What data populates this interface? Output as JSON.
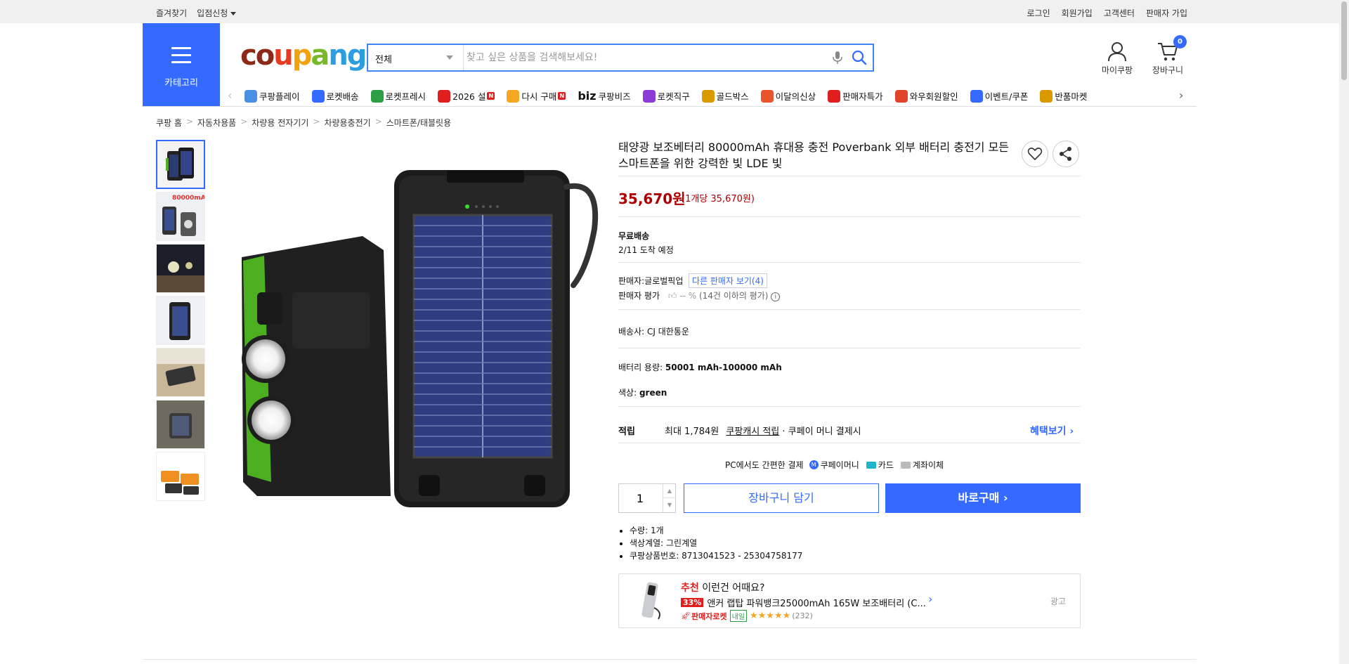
{
  "topbar": {
    "left": [
      "즐겨찾기",
      "입점신청"
    ],
    "right": [
      "로그인",
      "회원가입",
      "고객센터",
      "판매자 가입"
    ]
  },
  "header": {
    "category_label": "카테고리",
    "logo": {
      "c1": "co",
      "c2": "u",
      "c3": "p",
      "c4": "a",
      "c5": "ng"
    },
    "search_category": "전체",
    "search_placeholder": "찾고 싶은 상품을 검색해보세요!",
    "mycoupang_label": "마이쿠팡",
    "cart_label": "장바구니",
    "cart_count": "0"
  },
  "gnb": [
    {
      "label": "쿠팡플레이",
      "icon": "play-icon",
      "color": "#4a90e2"
    },
    {
      "label": "로켓배송",
      "icon": "rocket-icon",
      "color": "#346aff"
    },
    {
      "label": "로켓프레시",
      "icon": "rocket-fresh-icon",
      "color": "#2e9e44"
    },
    {
      "label": "2026 설",
      "icon": "gift-icon",
      "color": "#e01e1e",
      "badge": "N"
    },
    {
      "label": "다시 구매",
      "icon": "rebuy-icon",
      "color": "#f5a623",
      "badge": "N"
    },
    {
      "label": "쿠팡비즈",
      "icon": "biz-icon",
      "color": "#111",
      "prefix": "biz"
    },
    {
      "label": "로켓직구",
      "icon": "global-icon",
      "color": "#8b3ad6"
    },
    {
      "label": "골드박스",
      "icon": "goldbox-icon",
      "color": "#d99a00"
    },
    {
      "label": "이달의신상",
      "icon": "new-icon",
      "color": "#e8542b"
    },
    {
      "label": "판매자특가",
      "icon": "seller-deal-icon",
      "color": "#e01e1e"
    },
    {
      "label": "와우회원할인",
      "icon": "wow-icon",
      "color": "#e0442b"
    },
    {
      "label": "이벤트/쿠폰",
      "icon": "coupon-icon",
      "color": "#346aff"
    },
    {
      "label": "반품마켓",
      "icon": "return-market-icon",
      "color": "#d99a00"
    }
  ],
  "breadcrumb": [
    "쿠팡 홈",
    "자동차용품",
    "차량용 전자기기",
    "차량용충전기",
    "스마트폰/태블릿용"
  ],
  "product": {
    "title": "태양광 보조베터리 80000mAh 휴대용 충전 Poverbank 외부 배터리 충전기 모든 스마트폰을 위한 강력한 빛 LDE 빛",
    "price": "35,670원",
    "unit_price": "(1개당 35,670원)",
    "shipping_title": "무료배송",
    "arrival": "2/11 도착 예정",
    "seller_label": "판매자:",
    "seller_name": "글로벌픽업",
    "other_seller": "다른 판매자 보기(4)",
    "seller_rating_label": "판매자 평가",
    "seller_rating_value": "-- %",
    "seller_rating_note": "(14건 이하의 평가)",
    "courier_label": "배송사:",
    "courier_name": "CJ 대한통운",
    "battery_label": "배터리 용량:",
    "battery_value": "50001 mAh-100000 mAh",
    "color_label": "색상:",
    "color_value": "green",
    "reward_title": "적립",
    "reward_amount": "최대 1,784원",
    "reward_link": "쿠팡캐시 적립",
    "reward_desc": "· 쿠페이 머니 결제시",
    "benefit_link": "혜택보기",
    "pay_title": "PC에서도 간편한 결제",
    "pay_methods": [
      "쿠페이머니",
      "카드",
      "계좌이체"
    ],
    "quantity": "1",
    "cart_button": "장바구니 담기",
    "buy_button": "바로구매",
    "bullets": [
      "수량: 1개",
      "색상계열: 그린계열",
      "쿠팡상품번호: 8713041523 - 25304758177"
    ]
  },
  "recommend": {
    "head_red": "추천",
    "head_text": "이런건 어때요?",
    "discount": "33%",
    "name": "앤커 랩탑 파워뱅크25000mAh 165W 보조배터리 (C...",
    "seller_rocket": "판매자로켓",
    "naeil": "내일",
    "stars": "★★★★★",
    "reviews": "(232)",
    "ad": "광고"
  },
  "colors": {
    "accent": "#346aff",
    "price": "#ae0000"
  }
}
